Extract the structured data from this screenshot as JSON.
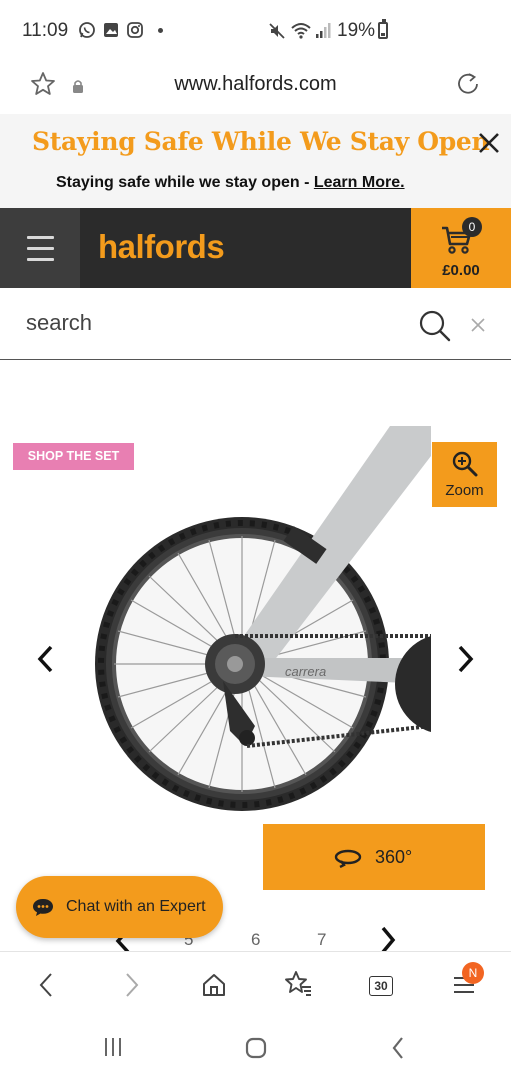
{
  "status_bar": {
    "time": "11:09",
    "battery": "19%",
    "icons": [
      "whatsapp-icon",
      "gallery-icon",
      "instagram-icon",
      "mute-icon",
      "wifi-icon",
      "signal-icon",
      "battery-icon"
    ]
  },
  "browser": {
    "url": "www.halfords.com",
    "tab_count": "30",
    "notification_badge": "N"
  },
  "notice": {
    "title": "Staying Safe While We Stay Open",
    "text": "Staying safe while we stay open - ",
    "link": "Learn More."
  },
  "header": {
    "logo": "halfords",
    "basket_count": "0",
    "basket_total": "£0.00"
  },
  "search": {
    "placeholder": "search"
  },
  "gallery": {
    "badge": "SHOP THE SET",
    "zoom_label": "Zoom",
    "spin_label": "360°",
    "pager": [
      "5",
      "6",
      "7"
    ]
  },
  "chat": {
    "label": "Chat with an Expert"
  },
  "colors": {
    "brand_orange": "#f39b1c",
    "header_dark": "#2b2b2b",
    "badge_pink": "#e87fb2",
    "notif_orange": "#f26522"
  }
}
